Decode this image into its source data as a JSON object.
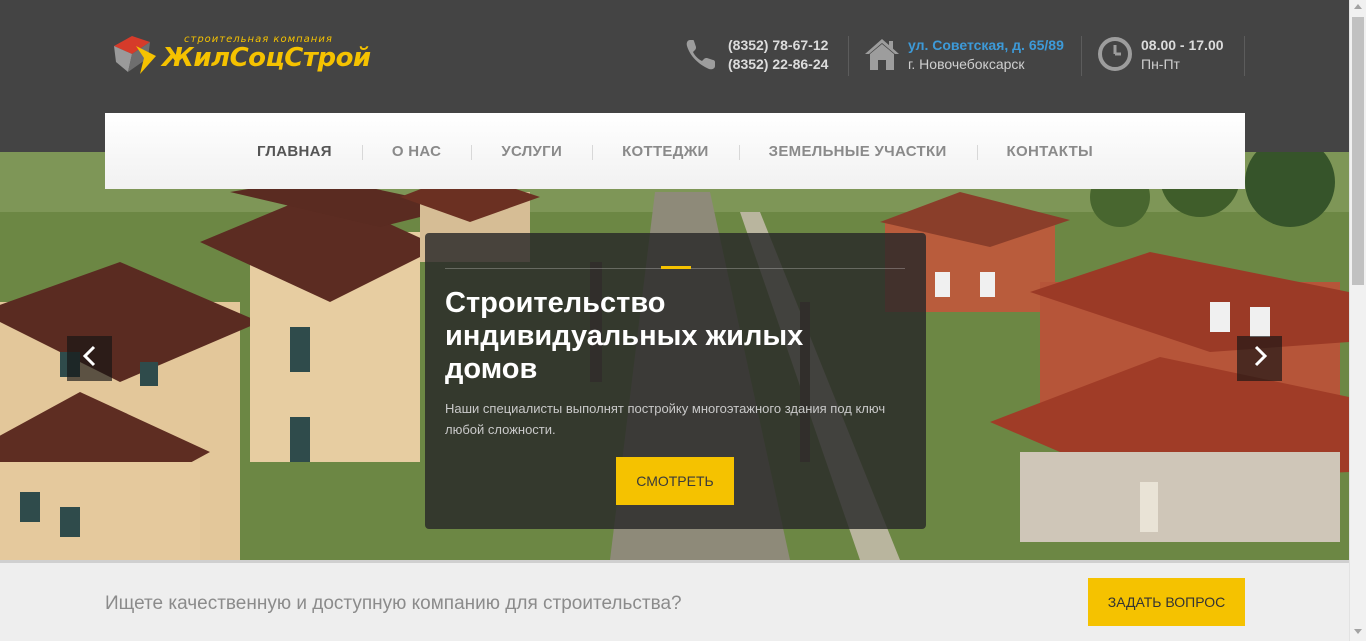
{
  "logo": {
    "tagline": "строительная компания",
    "name": "ЖилСоцСтрой"
  },
  "contacts": {
    "phone": {
      "icon": "phone-icon",
      "line1": "(8352) 78-67-12",
      "line2": "(8352) 22-86-24"
    },
    "address": {
      "icon": "house-icon",
      "line1": "ул. Советская, д. 65/89",
      "line2": "г. Новочебоксарск"
    },
    "hours": {
      "icon": "clock-icon",
      "line1": "08.00 - 17.00",
      "line2": "Пн-Пт"
    }
  },
  "nav": {
    "items": [
      {
        "label": "ГЛАВНАЯ"
      },
      {
        "label": "О НАС"
      },
      {
        "label": "УСЛУГИ"
      },
      {
        "label": "КОТТЕДЖИ"
      },
      {
        "label": "ЗЕМЕЛЬНЫЕ УЧАСТКИ"
      },
      {
        "label": "КОНТАКТЫ"
      }
    ]
  },
  "slider": {
    "title": "Строительство индивидуальных жилых домов",
    "text": "Наши специалисты выполнят постройку многоэтажного здания под ключ любой сложности.",
    "button": "СМОТРЕТЬ",
    "prev_icon": "chevron-left-icon",
    "next_icon": "chevron-right-icon"
  },
  "cta": {
    "text": "Ищете качественную и доступную компанию для строительства?",
    "button": "ЗАДАТЬ ВОПРОС"
  },
  "colors": {
    "accent": "#f5c200",
    "header_bg": "#444444",
    "address_blue": "#3d9ad8"
  }
}
